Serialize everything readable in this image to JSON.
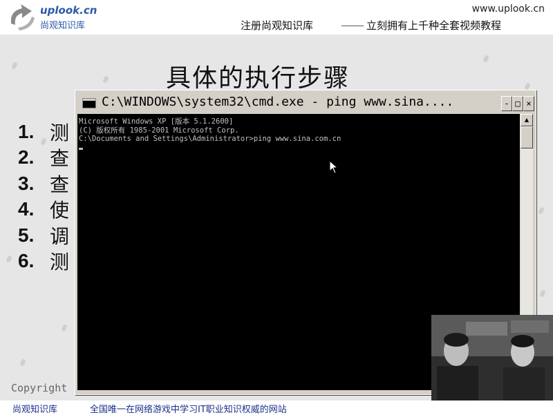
{
  "header": {
    "logo_name": "uplook.cn",
    "logo_sub": "尚观知识库",
    "site_url": "www.uplook.cn",
    "slogan_left": "注册尚观知识库",
    "slogan_right": "立刻拥有上千种全套视频教程"
  },
  "slide": {
    "title": "具体的执行步骤",
    "steps": [
      {
        "num": "1.",
        "text": "测"
      },
      {
        "num": "2.",
        "text": "查"
      },
      {
        "num": "3.",
        "text": "查"
      },
      {
        "num": "4.",
        "text": "使"
      },
      {
        "num": "5.",
        "text": "调"
      },
      {
        "num": "6.",
        "text": "测"
      }
    ],
    "copyright": "Copyright"
  },
  "cmd": {
    "title": "C:\\WINDOWS\\system32\\cmd.exe - ping www.sina....",
    "minimize": "-",
    "maximize": "□",
    "close": "×",
    "lines": [
      "Microsoft Windows XP [版本 5.1.2600]",
      "(C) 版权所有 1985-2001 Microsoft Corp.",
      "",
      "C:\\Documents and Settings\\Administrator>ping www.sina.com.cn"
    ]
  },
  "footer": {
    "left": "尚观知识库",
    "right": "全国唯一在网络游戏中学习IT职业知识权威的网站"
  },
  "colors": {
    "brand": "#2a5aa8",
    "footer_text": "#1a2f8a",
    "console_bg": "#000000",
    "console_text": "#c0c0c0"
  }
}
